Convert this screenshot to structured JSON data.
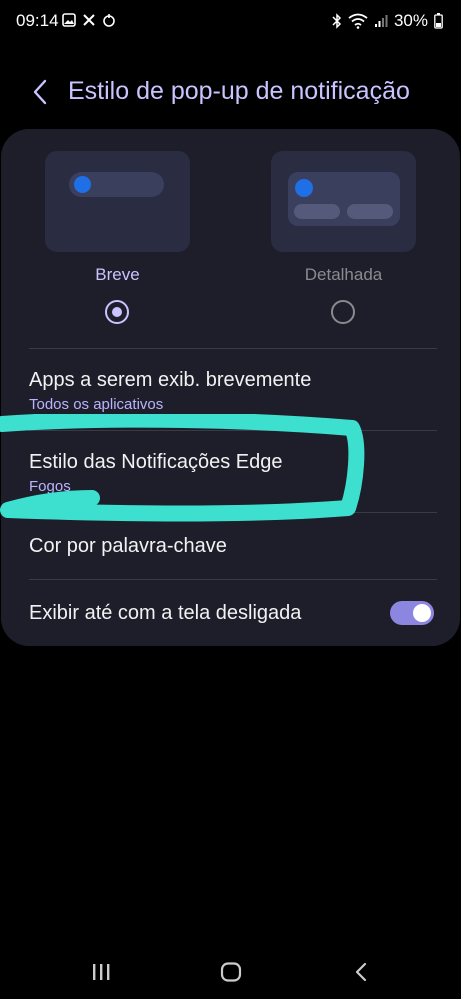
{
  "status_bar": {
    "time": "09:14",
    "battery": "30%",
    "left_icons": [
      "gallery-icon",
      "x-icon",
      "app-icon"
    ],
    "right_icons": [
      "bluetooth-icon",
      "wifi-icon",
      "signal-icon",
      "battery-icon"
    ]
  },
  "header": {
    "title": "Estilo de pop-up de notificação"
  },
  "styles": {
    "brief_label": "Breve",
    "detailed_label": "Detalhada",
    "selected": "Breve"
  },
  "settings": {
    "apps": {
      "title": "Apps a serem exib. brevemente",
      "value": "Todos os aplicativos"
    },
    "edge_style": {
      "title": "Estilo das Notificações Edge",
      "value": "Fogos"
    },
    "keyword_color": {
      "title": "Cor por palavra-chave"
    },
    "screen_off": {
      "title": "Exibir até com a tela desligada",
      "enabled": true
    }
  },
  "colors": {
    "accent": "#c9c4ff",
    "annotation": "#3de0cf",
    "card": "#1e1e2a"
  }
}
